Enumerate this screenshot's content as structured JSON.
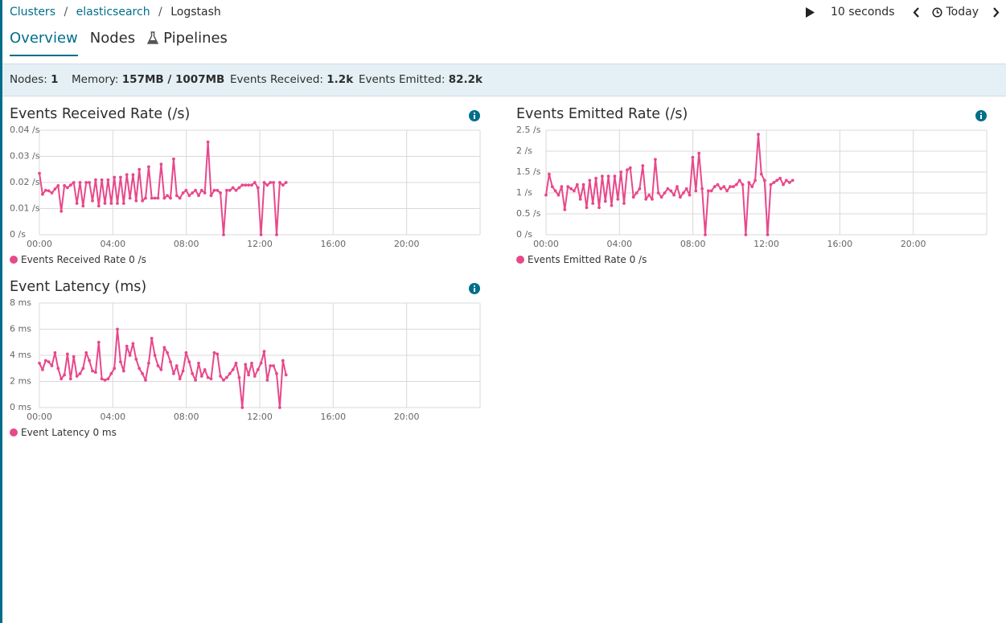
{
  "breadcrumb": {
    "clusters": "Clusters",
    "cluster": "elasticsearch",
    "current": "Logstash",
    "separator": "/"
  },
  "timepicker": {
    "interval": "10 seconds",
    "range": "Today"
  },
  "tabs": [
    {
      "label": "Overview",
      "active": true
    },
    {
      "label": "Nodes",
      "active": false
    },
    {
      "label": "Pipelines",
      "active": false,
      "icon": "flask-icon"
    }
  ],
  "status": {
    "nodes_label": "Nodes:",
    "nodes_value": "1",
    "memory_label": "Memory:",
    "memory_value": "157MB / 1007MB",
    "received_label": "Events Received:",
    "received_value": "1.2k",
    "emitted_label": "Events Emitted:",
    "emitted_value": "82.2k"
  },
  "colors": {
    "accent": "#006e8a",
    "series": "#e8488b",
    "status_bg": "#e4f0f5"
  },
  "charts": [
    {
      "title": "Events Received Rate (/s)",
      "legend": "Events Received Rate 0 /s",
      "info_icon": "info-icon"
    },
    {
      "title": "Events Emitted Rate (/s)",
      "legend": "Events Emitted Rate 0 /s",
      "info_icon": "info-icon"
    },
    {
      "title": "Event Latency (ms)",
      "legend": "Event Latency 0 ms",
      "info_icon": "info-icon"
    }
  ],
  "chart_data": [
    {
      "type": "line",
      "title": "Events Received Rate (/s)",
      "x_unit": "hour of day",
      "xlim": [
        0,
        24
      ],
      "ylim": [
        0,
        0.04
      ],
      "x_ticks": [
        "00:00",
        "04:00",
        "08:00",
        "12:00",
        "16:00",
        "20:00"
      ],
      "y_ticks": [
        "0 /s",
        "0.01 /s",
        "0.02 /s",
        "0.03 /s",
        "0.04 /s"
      ],
      "grid": true,
      "legend_position": "bottom-left",
      "series": [
        {
          "name": "Events Received Rate",
          "x": [
            0,
            0.17,
            0.34,
            0.51,
            0.68,
            0.85,
            1.02,
            1.19,
            1.36,
            1.53,
            1.7,
            1.87,
            2.04,
            2.21,
            2.38,
            2.55,
            2.72,
            2.89,
            3.06,
            3.23,
            3.4,
            3.57,
            3.74,
            3.91,
            4.08,
            4.25,
            4.42,
            4.59,
            4.76,
            4.93,
            5.1,
            5.27,
            5.44,
            5.61,
            5.78,
            5.95,
            6.12,
            6.29,
            6.46,
            6.63,
            6.8,
            6.97,
            7.14,
            7.31,
            7.48,
            7.65,
            7.82,
            7.99,
            8.16,
            8.33,
            8.5,
            8.67,
            8.84,
            9.01,
            9.18,
            9.35,
            9.52,
            9.69,
            9.86,
            10.03,
            10.2,
            10.37,
            10.54,
            10.71,
            10.88,
            11.05,
            11.22,
            11.39,
            11.56,
            11.73,
            11.9,
            12.07,
            12.24,
            12.41,
            12.58,
            12.75,
            12.92,
            13.09,
            13.26,
            13.43
          ],
          "y": [
            0.0235,
            0.0155,
            0.017,
            0.0168,
            0.016,
            0.0175,
            0.0188,
            0.009,
            0.0188,
            0.018,
            0.019,
            0.02,
            0.012,
            0.02,
            0.011,
            0.02,
            0.02,
            0.013,
            0.021,
            0.011,
            0.021,
            0.012,
            0.021,
            0.012,
            0.022,
            0.012,
            0.022,
            0.012,
            0.023,
            0.014,
            0.023,
            0.013,
            0.025,
            0.013,
            0.014,
            0.026,
            0.014,
            0.014,
            0.014,
            0.027,
            0.014,
            0.015,
            0.014,
            0.029,
            0.015,
            0.014,
            0.016,
            0.017,
            0.015,
            0.016,
            0.017,
            0.015,
            0.017,
            0.016,
            0.0355,
            0.015,
            0.017,
            0.017,
            0.016,
            0.0,
            0.017,
            0.017,
            0.018,
            0.017,
            0.018,
            0.019,
            0.019,
            0.019,
            0.019,
            0.02,
            0.018,
            0.0,
            0.02,
            0.019,
            0.02,
            0.02,
            0.0,
            0.02,
            0.019,
            0.02
          ]
        }
      ]
    },
    {
      "type": "line",
      "title": "Events Emitted Rate (/s)",
      "x_unit": "hour of day",
      "xlim": [
        0,
        24
      ],
      "ylim": [
        0,
        2.5
      ],
      "x_ticks": [
        "00:00",
        "04:00",
        "08:00",
        "12:00",
        "16:00",
        "20:00"
      ],
      "y_ticks": [
        "0 /s",
        "0.5 /s",
        "1 /s",
        "1.5 /s",
        "2 /s",
        "2.5 /s"
      ],
      "grid": true,
      "legend_position": "bottom-left",
      "series": [
        {
          "name": "Events Emitted Rate",
          "x": [
            0,
            0.17,
            0.34,
            0.51,
            0.68,
            0.85,
            1.02,
            1.19,
            1.36,
            1.53,
            1.7,
            1.87,
            2.04,
            2.21,
            2.38,
            2.55,
            2.72,
            2.89,
            3.06,
            3.23,
            3.4,
            3.57,
            3.74,
            3.91,
            4.08,
            4.25,
            4.42,
            4.59,
            4.76,
            4.93,
            5.1,
            5.27,
            5.44,
            5.61,
            5.78,
            5.95,
            6.12,
            6.29,
            6.46,
            6.63,
            6.8,
            6.97,
            7.14,
            7.31,
            7.48,
            7.65,
            7.82,
            7.99,
            8.16,
            8.33,
            8.5,
            8.67,
            8.84,
            9.01,
            9.18,
            9.35,
            9.52,
            9.69,
            9.86,
            10.03,
            10.2,
            10.37,
            10.54,
            10.71,
            10.88,
            11.05,
            11.22,
            11.39,
            11.56,
            11.73,
            11.9,
            12.07,
            12.24,
            12.41,
            12.58,
            12.75,
            12.92,
            13.09,
            13.26,
            13.43
          ],
          "y": [
            0.95,
            1.45,
            1.15,
            1.05,
            0.95,
            1.15,
            0.6,
            1.15,
            1.1,
            1.05,
            1.2,
            0.85,
            1.2,
            0.65,
            1.3,
            0.75,
            1.35,
            0.65,
            1.4,
            0.8,
            1.4,
            0.7,
            1.4,
            0.85,
            1.5,
            0.75,
            1.55,
            1.6,
            0.9,
            1.0,
            1.1,
            1.65,
            0.85,
            0.95,
            0.85,
            1.8,
            1.0,
            0.9,
            1.0,
            1.1,
            1.05,
            0.95,
            1.15,
            0.9,
            1.0,
            1.1,
            0.95,
            1.85,
            1.05,
            1.95,
            1.1,
            0.0,
            1.05,
            1.05,
            1.15,
            1.2,
            1.1,
            1.15,
            1.05,
            1.15,
            1.15,
            1.2,
            1.3,
            1.2,
            0.0,
            1.25,
            1.15,
            1.3,
            2.4,
            1.45,
            1.3,
            0.0,
            1.2,
            1.25,
            1.3,
            1.35,
            1.2,
            1.3,
            1.25,
            1.3
          ]
        }
      ]
    },
    {
      "type": "line",
      "title": "Event Latency (ms)",
      "x_unit": "hour of day",
      "xlim": [
        0,
        24
      ],
      "ylim": [
        0,
        8
      ],
      "x_ticks": [
        "00:00",
        "04:00",
        "08:00",
        "12:00",
        "16:00",
        "20:00"
      ],
      "y_ticks": [
        "0 ms",
        "2 ms",
        "4 ms",
        "6 ms",
        "8 ms"
      ],
      "grid": true,
      "legend_position": "bottom-left",
      "series": [
        {
          "name": "Event Latency",
          "x": [
            0,
            0.17,
            0.34,
            0.51,
            0.68,
            0.85,
            1.02,
            1.19,
            1.36,
            1.53,
            1.7,
            1.87,
            2.04,
            2.21,
            2.38,
            2.55,
            2.72,
            2.89,
            3.06,
            3.23,
            3.4,
            3.57,
            3.74,
            3.91,
            4.08,
            4.25,
            4.42,
            4.59,
            4.76,
            4.93,
            5.1,
            5.27,
            5.44,
            5.61,
            5.78,
            5.95,
            6.12,
            6.29,
            6.46,
            6.63,
            6.8,
            6.97,
            7.14,
            7.31,
            7.48,
            7.65,
            7.82,
            7.99,
            8.16,
            8.33,
            8.5,
            8.67,
            8.84,
            9.01,
            9.18,
            9.35,
            9.52,
            9.69,
            9.86,
            10.03,
            10.2,
            10.37,
            10.54,
            10.71,
            10.88,
            11.05,
            11.22,
            11.39,
            11.56,
            11.73,
            11.9,
            12.07,
            12.24,
            12.41,
            12.58,
            12.75,
            12.92,
            13.09,
            13.26,
            13.43
          ],
          "y": [
            3.4,
            2.9,
            3.6,
            3.5,
            3.2,
            4.2,
            3.0,
            2.2,
            2.5,
            4.1,
            2.2,
            3.9,
            2.4,
            2.6,
            3.0,
            4.2,
            3.6,
            2.8,
            2.7,
            5.0,
            2.2,
            2.1,
            2.2,
            2.6,
            3.0,
            6.0,
            3.5,
            2.8,
            4.7,
            4.0,
            4.9,
            3.7,
            3.0,
            2.6,
            2.1,
            3.4,
            5.3,
            4.0,
            3.2,
            2.9,
            4.6,
            4.2,
            3.5,
            2.6,
            3.2,
            2.2,
            2.8,
            4.2,
            3.5,
            2.6,
            2.1,
            3.4,
            2.4,
            2.9,
            2.3,
            2.2,
            4.2,
            4.1,
            2.4,
            2.1,
            2.3,
            2.6,
            2.9,
            3.4,
            2.3,
            0.0,
            3.3,
            2.5,
            3.4,
            2.4,
            2.9,
            3.4,
            4.3,
            2.1,
            3.2,
            3.2,
            2.6,
            0.0,
            3.6,
            2.5
          ]
        }
      ]
    }
  ]
}
